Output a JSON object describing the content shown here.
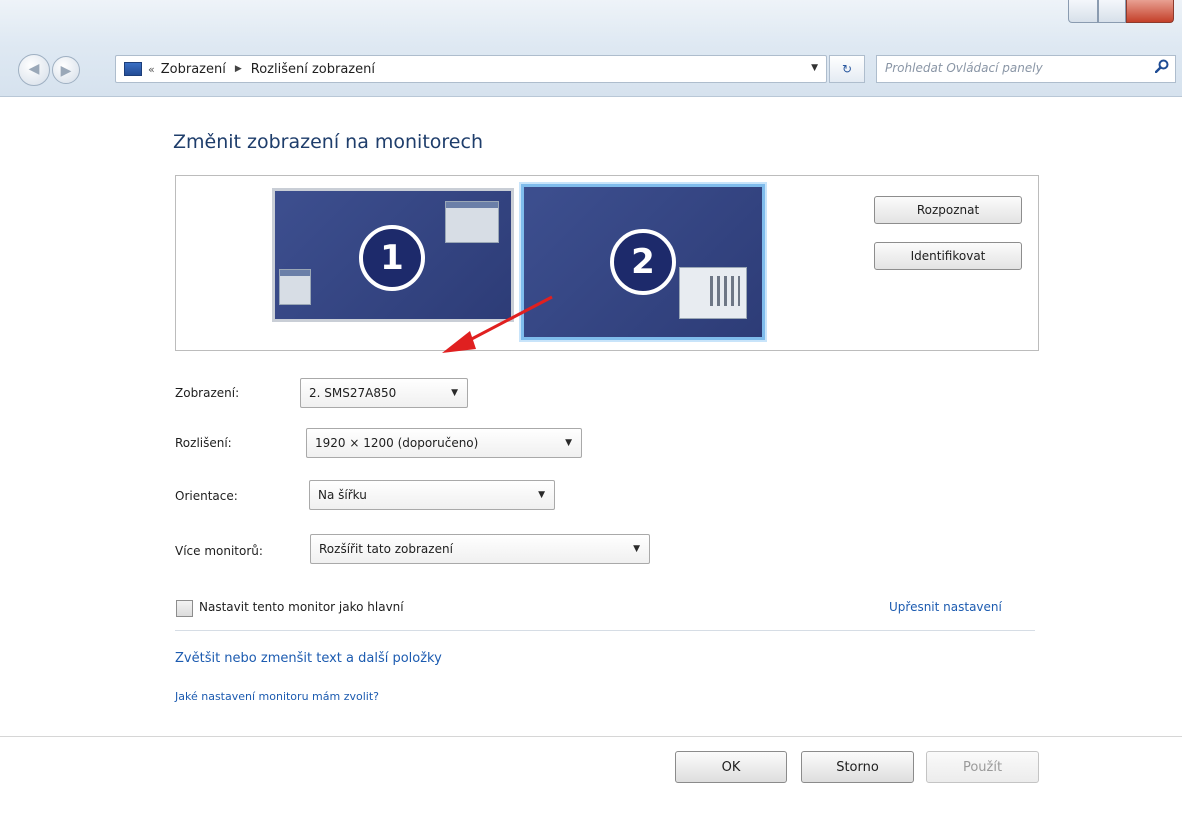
{
  "window": {
    "breadcrumbs": [
      "Zobrazení",
      "Rozlišení zobrazení"
    ],
    "search_placeholder": "Prohledat Ovládací panely"
  },
  "content": {
    "title": "Změnit zobrazení na monitorech",
    "monitors": [
      "1",
      "2"
    ],
    "detect_label": "Rozpoznat",
    "identify_label": "Identifikovat"
  },
  "settings": {
    "display": {
      "label": "Zobrazení:",
      "value": "2. SMS27A850"
    },
    "resolution": {
      "label": "Rozlišení:",
      "value": "1920 × 1200 (doporučeno)"
    },
    "orientation": {
      "label": "Orientace:",
      "value": "Na šířku"
    },
    "multiple_monitors": {
      "label": "Více monitorů:",
      "value": "Rozšířit tato zobrazení"
    }
  },
  "main_monitor_checkbox": {
    "label": "Nastavit tento monitor jako hlavní",
    "checked": false
  },
  "links": {
    "advanced": "Upřesnit nastavení",
    "text_size": "Zvětšit nebo zmenšit text a další položky",
    "which_settings": "Jaké nastavení monitoru mám zvolit?"
  },
  "buttons": {
    "ok": "OK",
    "cancel": "Storno",
    "apply": "Použít"
  },
  "colors": {
    "accent_link": "#1c5bb0",
    "title": "#1e3d6b",
    "monitor": "#34467f",
    "arrow": "#e02020"
  }
}
